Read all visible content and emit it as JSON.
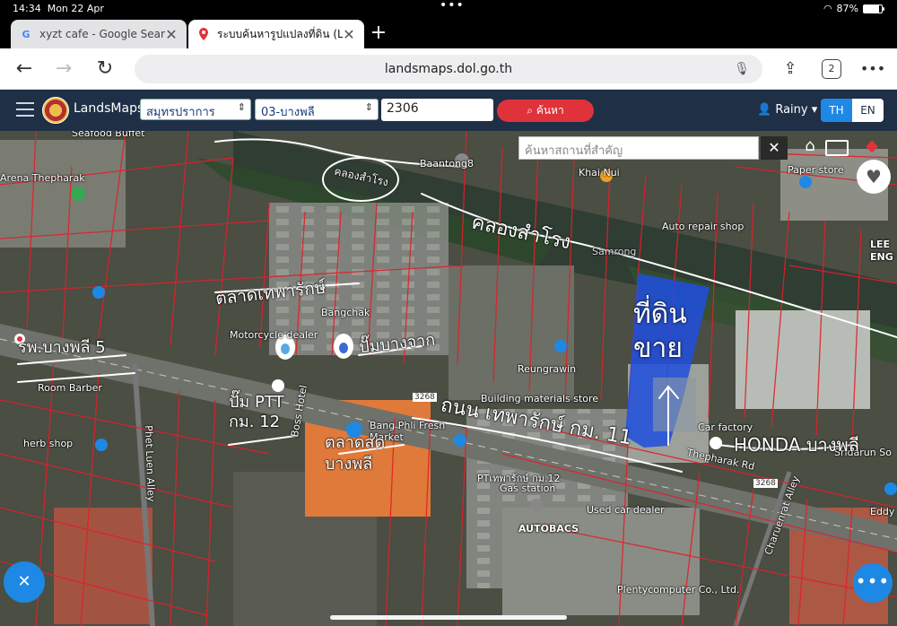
{
  "status_bar": {
    "time": "14:34",
    "date": "Mon 22 Apr",
    "battery": "87%"
  },
  "tabs": [
    {
      "label": "xyzt cafe - Google Search",
      "favicon": "G",
      "active": false
    },
    {
      "label": "ระบบค้นหารูปแปลงที่ดิน (Land",
      "favicon": "pin-icon",
      "active": true
    }
  ],
  "address_bar": {
    "url": "landsmaps.dol.go.th",
    "tab_count": "2"
  },
  "app_header": {
    "app_name": "LandsMaps",
    "province": "สมุทรปราการ",
    "district": "03-บางพลี",
    "parcel_no": "2306",
    "search_label": "ค้นหา",
    "user_name": "Rainy",
    "lang_th": "TH",
    "lang_en": "EN",
    "accent": "#e0323a",
    "header_bg": "#1e2f46"
  },
  "map": {
    "place_search_placeholder": "ค้นหาสถานที่สำคัญ",
    "labels": {
      "arena": "Arena Thepharak",
      "baantong": "Baantong8",
      "khaimuk": "Khai Nui",
      "paper": "Paper store",
      "auto_repair": "Auto repair shop",
      "samrong": "Samrong",
      "leeng": "LEE ENG",
      "moto": "Motorcycle dealer",
      "bangchak": "Bangchak",
      "room_barber": "Room Barber",
      "herb": "herb shop",
      "reungrawin": "Reungrawin",
      "building": "Building materials store",
      "car_factory": "Car factory",
      "bangphli_fresh": "Bang Phli Fresh Market",
      "boss_hotel": "Boss Hotel",
      "phetluen": "Phet Luen Alley",
      "pt_station": "PTเทพารักษ์ กม.12",
      "gas": "Gas station",
      "used_car": "Used car dealer",
      "autobacs": "AUTOBACS",
      "thepharak_rd": "Thepharak Rd",
      "plenty": "Plentycomputer Co., Ltd.",
      "charuen": "Charuenrat Alley",
      "sridarun": "Sridarun So",
      "eddy": "Eddy",
      "seafood": "Seafood Buffet",
      "r3268a": "3268",
      "r3268b": "3268"
    },
    "annotations": {
      "canal_circle": "คลองสำโรง",
      "canal_main": "คลองสำโรง",
      "market_north": "ตลาดเทพารักษ์",
      "hospital": "รพ.บางพลี 5",
      "ptt_pump": "ปั๊ม PTT กม. 12",
      "pump_bangchak": "ปั๊มบางจาก",
      "land_for_sale": "ที่ดินขาย",
      "road": "ถนน เทพารักษ์ กม. 11",
      "market_south": "ตลาดสดบางพลี",
      "honda": "HONDA บางพลี"
    },
    "colors": {
      "parcel_line": "#e0202a",
      "sale_area": "#1f4fe0",
      "annotation": "#ffffff"
    }
  }
}
